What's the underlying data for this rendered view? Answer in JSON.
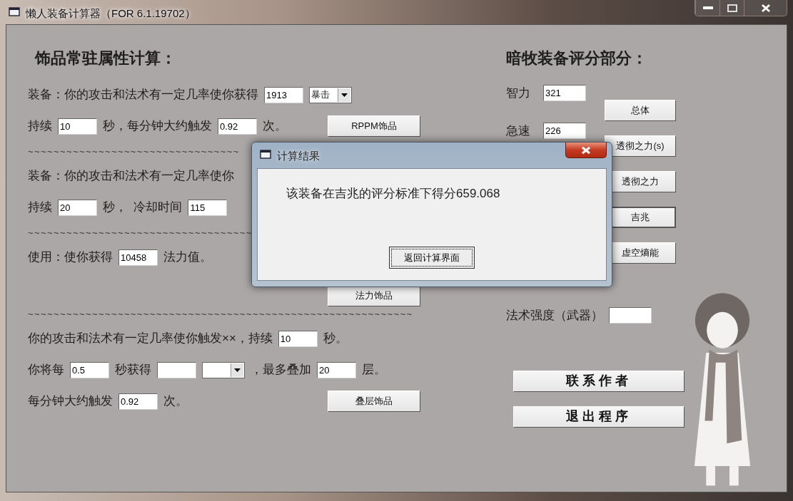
{
  "window": {
    "title": "懒人装备计算器（FOR 6.1.19702）"
  },
  "trinket_section": {
    "heading": "饰品常驻属性计算：",
    "rows": [
      {
        "kind": "fields",
        "parts": [
          {
            "kind": "text",
            "text": "装备：你的攻击和法术有一定几率使你获得"
          },
          {
            "kind": "input",
            "value": "1913"
          },
          {
            "kind": "select",
            "value": "暴击"
          }
        ]
      },
      {
        "kind": "fields",
        "parts": [
          {
            "kind": "text",
            "text": "持续"
          },
          {
            "kind": "input",
            "value": "10"
          },
          {
            "kind": "text",
            "text": "秒，每分钟大约触发"
          },
          {
            "kind": "input",
            "value": "0.92"
          },
          {
            "kind": "text",
            "text": "次。"
          }
        ],
        "button": "RPPM饰品"
      },
      {
        "kind": "divider",
        "text": "~~~~~~~~~~~~~~~~~~~~~~~~~~~~~~~~~"
      },
      {
        "kind": "fields",
        "parts": [
          {
            "kind": "text",
            "text": "装备：你的攻击和法术有一定几率使你"
          }
        ]
      },
      {
        "kind": "fields",
        "parts": [
          {
            "kind": "text",
            "text": "持续"
          },
          {
            "kind": "input",
            "value": "20"
          },
          {
            "kind": "text",
            "text": "秒，  冷却时间"
          },
          {
            "kind": "input",
            "value": "115"
          }
        ]
      },
      {
        "kind": "divider",
        "text": "~~~~~~~~~~~~~~~~~~~~~~~~~~~~~~~~~~~"
      },
      {
        "kind": "fields",
        "parts": [
          {
            "kind": "text",
            "text": "使用：使你获得"
          },
          {
            "kind": "input",
            "value": "10458"
          },
          {
            "kind": "text",
            "text": "法力值。"
          }
        ]
      },
      {
        "kind": "fields",
        "parts": [],
        "button": "法力饰品"
      },
      {
        "kind": "divider",
        "text": "~~~~~~~~~~~~~~~~~~~~~~~~~~~~~~~~~~~~~~~~~~~~~~~~~~~~~~~~~~~~"
      },
      {
        "kind": "fields",
        "parts": [
          {
            "kind": "text",
            "text": "你的攻击和法术有一定几率使你触发××，持续"
          },
          {
            "kind": "input",
            "value": "10"
          },
          {
            "kind": "text",
            "text": "秒。"
          }
        ]
      },
      {
        "kind": "fields",
        "parts": [
          {
            "kind": "text",
            "text": "你将每"
          },
          {
            "kind": "input",
            "value": "0.5"
          },
          {
            "kind": "text",
            "text": "秒获得"
          },
          {
            "kind": "input"
          },
          {
            "kind": "select"
          },
          {
            "kind": "text",
            "text": "，最多叠加"
          },
          {
            "kind": "input",
            "value": "20"
          },
          {
            "kind": "text",
            "text": "层。"
          }
        ]
      },
      {
        "kind": "fields",
        "parts": [
          {
            "kind": "text",
            "text": "每分钟大约触发"
          },
          {
            "kind": "input",
            "value": "0.92"
          },
          {
            "kind": "text",
            "text": "次。"
          }
        ],
        "button": "叠层饰品"
      }
    ]
  },
  "priest_section": {
    "heading": "暗牧装备评分部分：",
    "stats": [
      {
        "label": "智力",
        "value": "321"
      },
      {
        "label": "急速",
        "value": "226"
      }
    ],
    "buttons": [
      {
        "label": "总体",
        "selected": false
      },
      {
        "label": "透彻之力(s)",
        "selected": false
      },
      {
        "label": "透彻之力",
        "selected": false
      },
      {
        "label": "吉兆",
        "selected": true
      },
      {
        "label": "虚空熵能",
        "selected": false
      }
    ],
    "weapon_spell_power": {
      "label": "法术强度（武器）"
    },
    "actions": [
      "联系作者",
      "退出程序"
    ]
  },
  "dialog": {
    "title": "计算结果",
    "message": "该装备在吉兆的评分标准下得分659.068",
    "button": "返回计算界面"
  }
}
